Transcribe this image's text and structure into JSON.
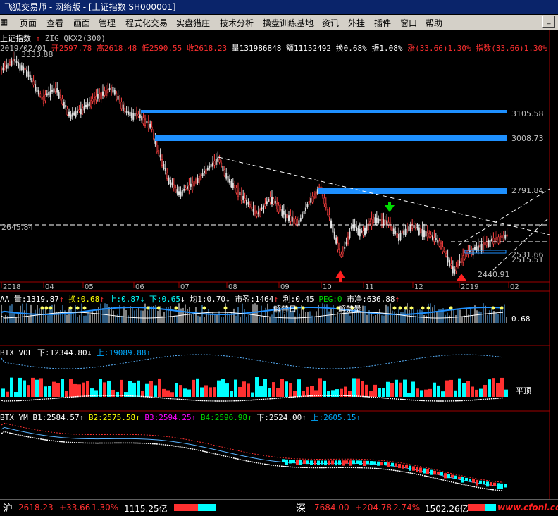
{
  "window": {
    "title": "飞狐交易师 - 网络版 - [上证指数 SH000001]"
  },
  "menu": [
    "页面",
    "查看",
    "画面",
    "管理",
    "程式化交易",
    "实盘猎庄",
    "技术分析",
    "操盘训练基地",
    "资讯",
    "外挂",
    "插件",
    "窗口",
    "帮助"
  ],
  "main_header": {
    "name": "上证指数",
    "indicator": "ZIG QKX2(300)",
    "date": "2019/02/01",
    "open": "开2597.78",
    "high": "高2618.48",
    "low": "低2590.55",
    "close": "收2618.23",
    "volume": "量131986848",
    "amount": "额11152492",
    "turnover": "换0.68%",
    "amplitude": "振1.08%",
    "change": "涨(33.66)1.30% 指数(33.66)1.30%"
  },
  "price_labels": {
    "top": "3333.88",
    "l1": "3105.58",
    "l2": "3008.73",
    "l3": "2791.84",
    "l4": "2531.66",
    "l5": "2515.51",
    "low": "2440.91",
    "left": "2645.84"
  },
  "time_axis": [
    "2018",
    "04",
    "05",
    "06",
    "07",
    "08",
    "09",
    "10",
    "11",
    "12",
    "2019",
    "02"
  ],
  "panel_aa": {
    "prefix": "AA",
    "vol": "量:1319.87",
    "huan": "换:0.68",
    "up": "上:0.87",
    "down": "下:0.65",
    "avg": "均1:0.70",
    "pe": "市盈:1464",
    "profit": "利:0.45",
    "peg": "PEG:0",
    "net": "市净:636.88",
    "note1": "解禁日",
    "note2": "解禁量",
    "value": "0.68"
  },
  "panel_vol": {
    "prefix": "BTX_VOL",
    "down": "下:12344.80",
    "up": "上:19089.88",
    "note": "平顶"
  },
  "panel_ym": {
    "prefix": "BTX_YM",
    "b1": "B1:2584.57",
    "b2": "B2:2575.58",
    "b3": "B3:2594.25",
    "b4": "B4:2596.98",
    "down": "下:2524.00",
    "up": "上:2605.15"
  },
  "status_bar": {
    "sh_label": "沪",
    "sh_price": "2618.23",
    "sh_change": "+33.66",
    "sh_pct": "1.30%",
    "sh_amount": "1115.25亿",
    "sz_label": "深",
    "sz_price": "7684.00",
    "sz_change": "+204.78",
    "sz_pct": "2.74%",
    "sz_amount": "1502.26亿",
    "watermark": "www.cfonl.com"
  },
  "colors": {
    "up": "#ff3030",
    "down": "#00ffff",
    "level": "#1e90ff",
    "text_yellow": "#ffff00"
  }
}
